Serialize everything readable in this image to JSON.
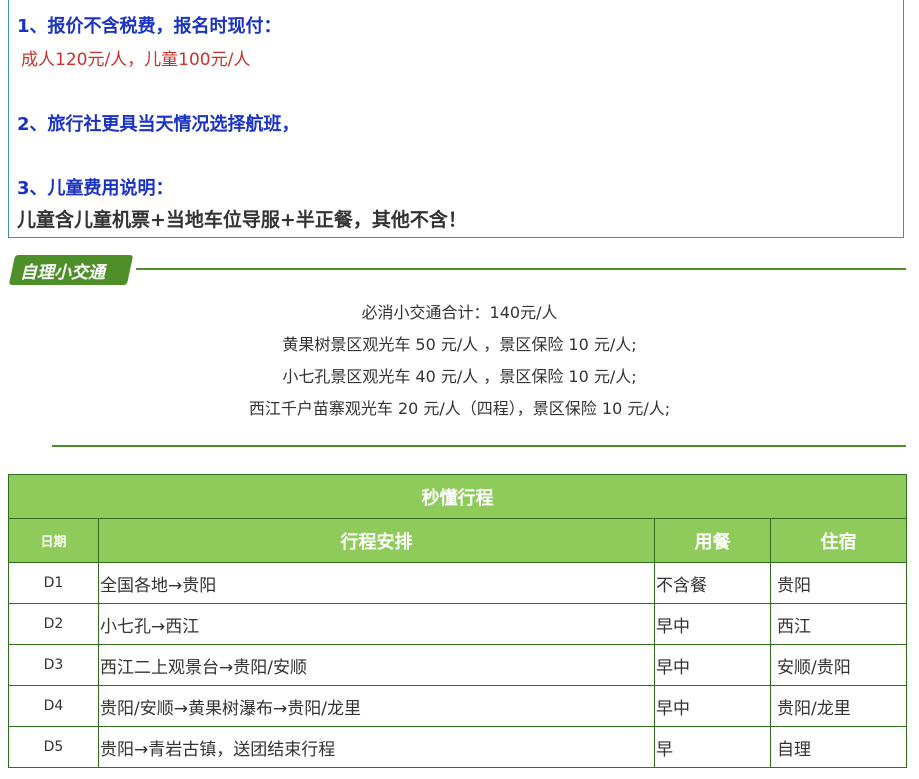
{
  "notice": {
    "line1": "1、报价不含税费，报名时现付：",
    "line2": "成人120元/人，儿童100元/人",
    "line3": "2、旅行社更具当天情况选择航班，",
    "line4": "3、儿童费用说明：",
    "line5": "儿童含儿童机票+当地车位导服+半正餐，其他不含！"
  },
  "transport": {
    "title": "自理小交通",
    "lines": [
      "必消小交通合计：140元/人",
      "黄果树景区观光车 50 元/人 ，景区保险 10 元/人;",
      "小七孔景区观光车 40 元/人 ，景区保险 10 元/人;",
      "西江千户苗寨观光车 20 元/人（四程），景区保险 10 元/人;"
    ]
  },
  "itinerary": {
    "title": "秒懂行程",
    "headers": {
      "day": "日期",
      "plan": "行程安排",
      "meals": "用餐",
      "lodging": "住宿"
    },
    "rows": [
      {
        "day": "D1",
        "plan": "全国各地→贵阳",
        "meals": "不含餐",
        "lodging": "贵阳"
      },
      {
        "day": "D2",
        "plan": "小七孔→西江",
        "meals": "早中",
        "lodging": "西江"
      },
      {
        "day": "D3",
        "plan": "西江二上观景台→贵阳/安顺",
        "meals": "早中",
        "lodging": "安顺/贵阳"
      },
      {
        "day": "D4",
        "plan": "贵阳/安顺→黄果树瀑布→贵阳/龙里",
        "meals": "早中",
        "lodging": "贵阳/龙里"
      },
      {
        "day": "D5",
        "plan": "贵阳→青岩古镇，送团结束行程",
        "meals": "早",
        "lodging": "自理"
      }
    ]
  },
  "colors": {
    "accent_green": "#4e8f2a",
    "header_green": "#8ecb5a",
    "blue": "#1a33c4",
    "red": "#c8322c"
  }
}
